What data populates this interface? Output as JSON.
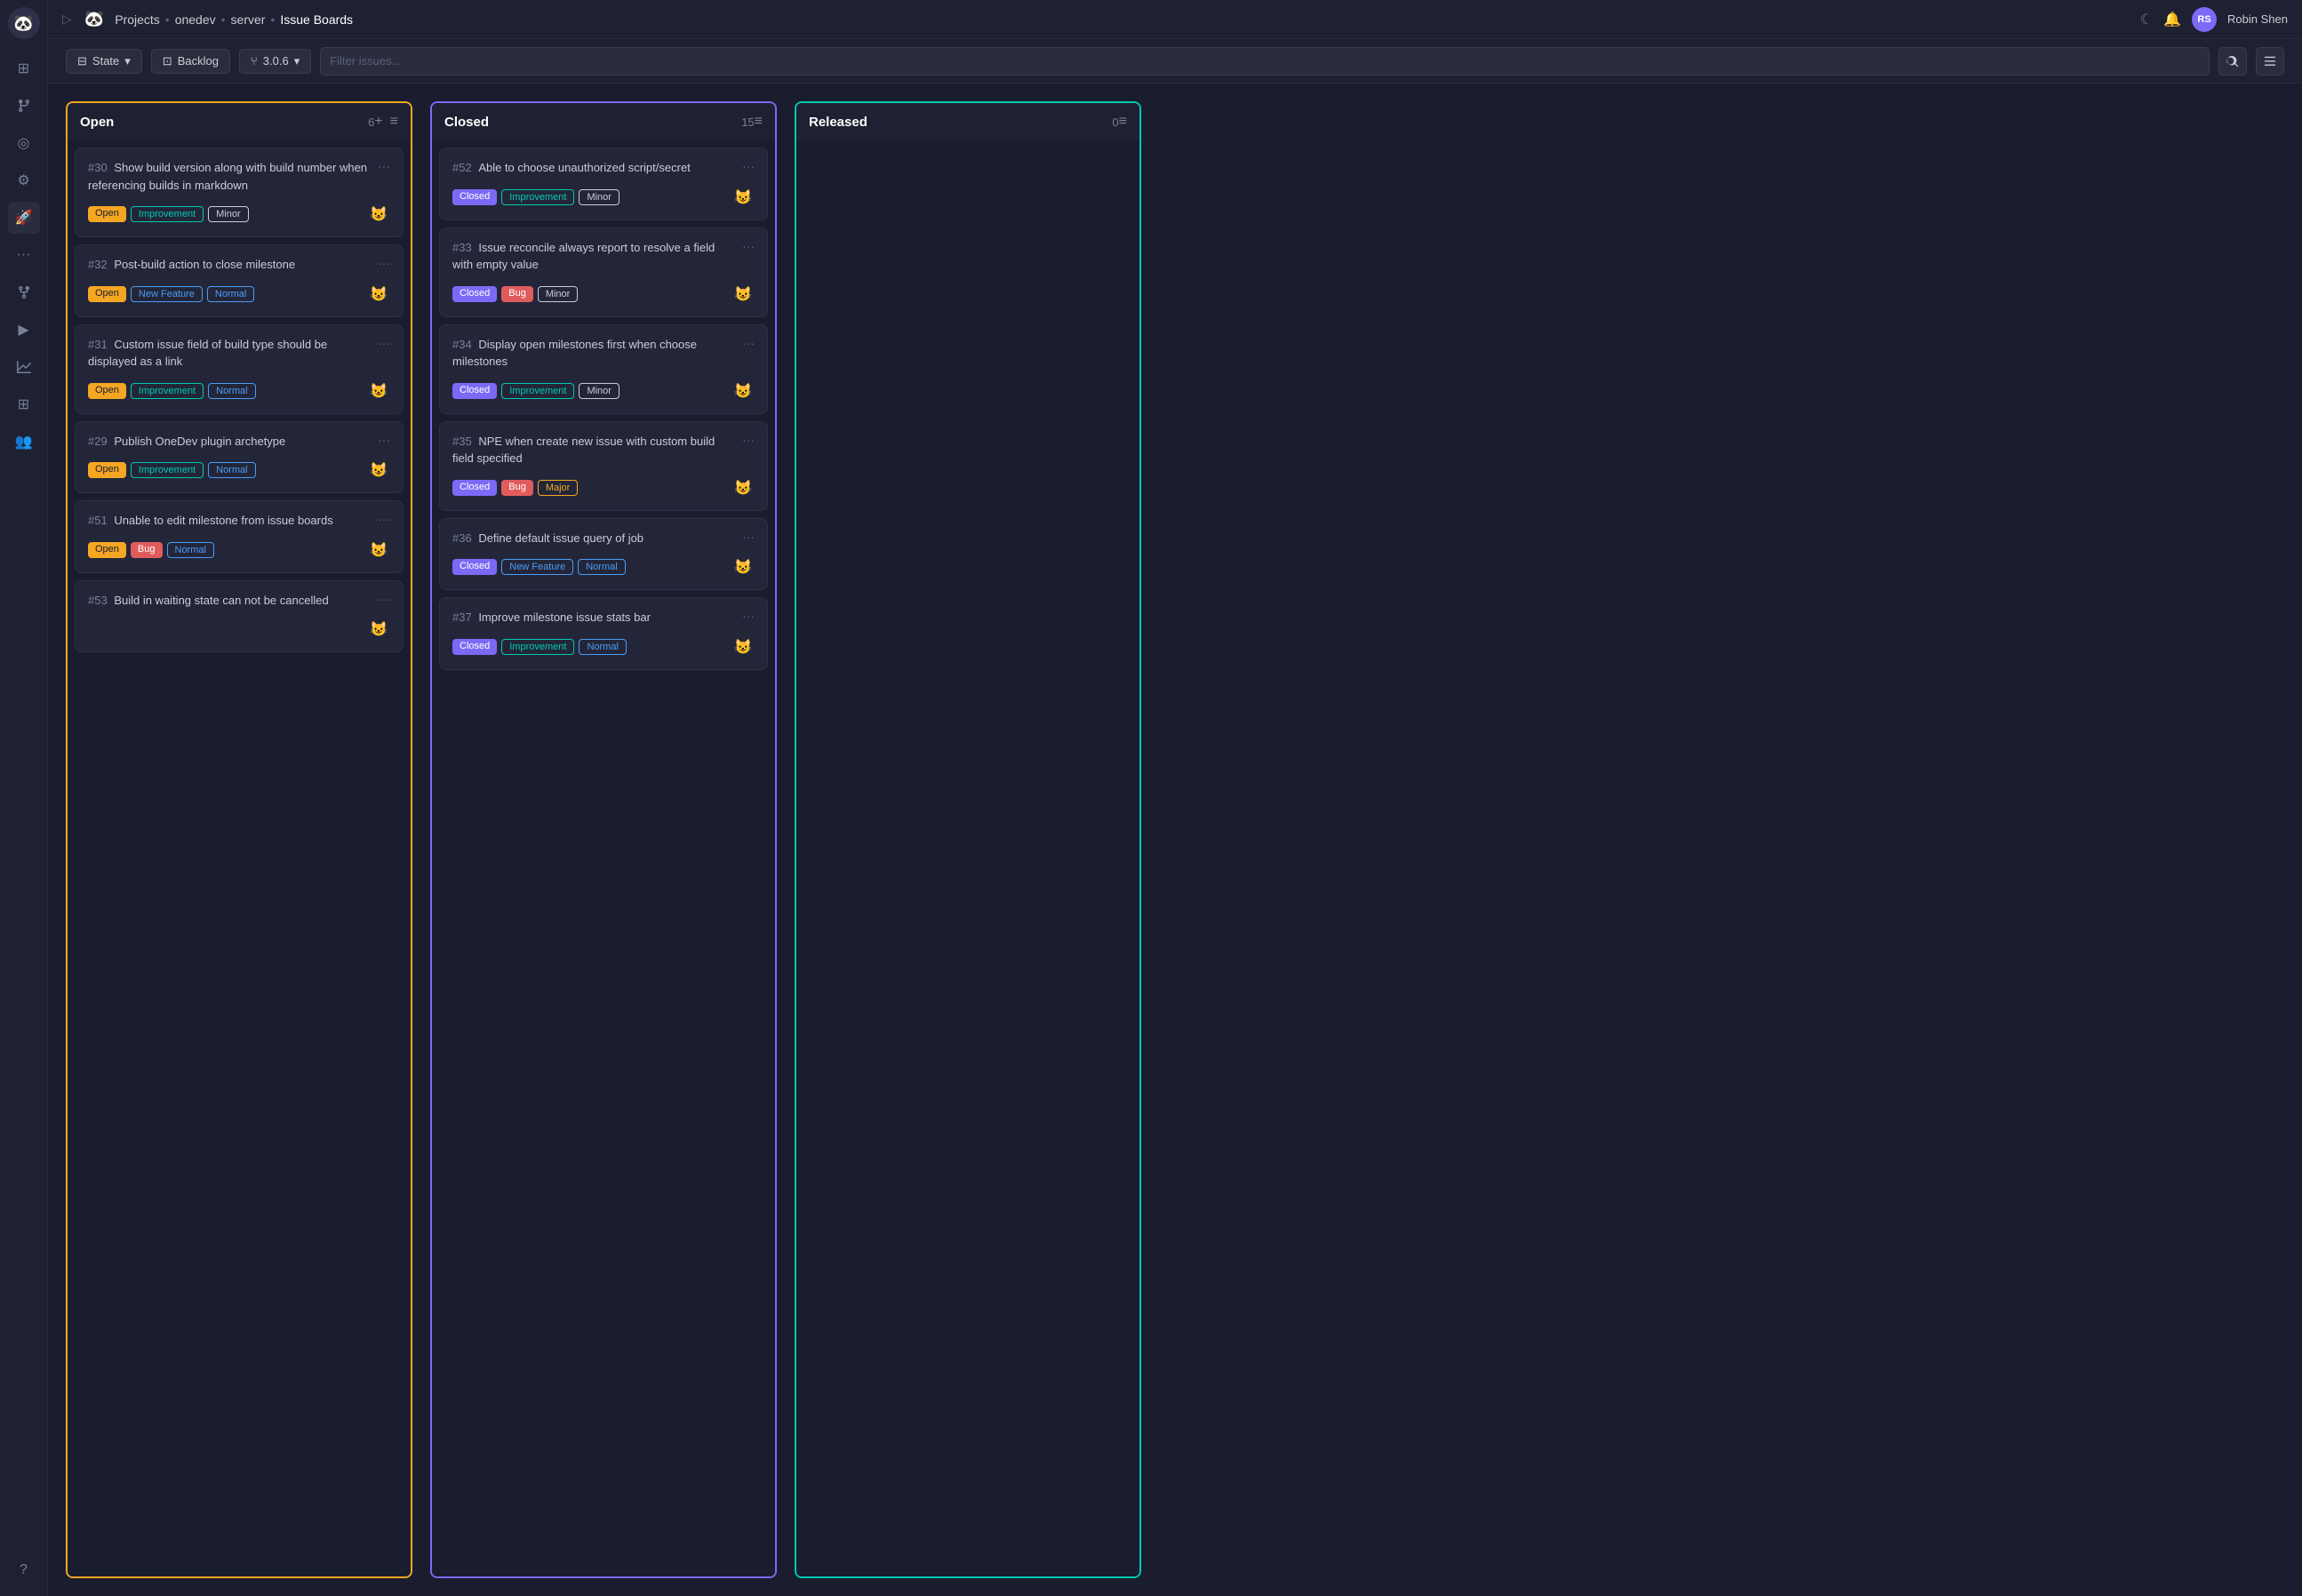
{
  "app": {
    "logo": "🐼",
    "breadcrumb": [
      "Projects",
      "onedev",
      "server",
      "Issue Boards"
    ]
  },
  "topnav": {
    "actions": {
      "moon_icon": "☾",
      "bell_icon": "🔔",
      "user_name": "Robin Shen"
    }
  },
  "toolbar": {
    "state_label": "State",
    "backlog_label": "Backlog",
    "version_label": "3.0.6",
    "search_placeholder": "Filter issues...",
    "chevron": "▾"
  },
  "sidebar": {
    "icons": [
      {
        "name": "dashboard",
        "symbol": "⊞"
      },
      {
        "name": "git-branches",
        "symbol": "⑂"
      },
      {
        "name": "releases",
        "symbol": "◎"
      },
      {
        "name": "settings",
        "symbol": "⚙"
      },
      {
        "name": "rocket",
        "symbol": "🚀"
      },
      {
        "name": "more",
        "symbol": "···"
      },
      {
        "name": "git-merge",
        "symbol": "⑂"
      },
      {
        "name": "build",
        "symbol": "▶"
      },
      {
        "name": "chart",
        "symbol": "📊"
      },
      {
        "name": "grid",
        "symbol": "⊞"
      },
      {
        "name": "team",
        "symbol": "👥"
      },
      {
        "name": "help",
        "symbol": "?"
      }
    ]
  },
  "columns": [
    {
      "id": "open",
      "title": "Open",
      "count": 6,
      "color_class": "column-open",
      "cards": [
        {
          "id": "30",
          "title": "Show build version along with build number when referencing builds in markdown",
          "tags": [
            {
              "label": "Open",
              "class": "tag-open"
            },
            {
              "label": "Improvement",
              "class": "tag-improvement"
            },
            {
              "label": "Minor",
              "class": "tag-minor"
            }
          ],
          "avatar": "😺"
        },
        {
          "id": "32",
          "title": "Post-build action to close milestone",
          "tags": [
            {
              "label": "Open",
              "class": "tag-open"
            },
            {
              "label": "New Feature",
              "class": "tag-new-feature"
            },
            {
              "label": "Normal",
              "class": "tag-normal"
            }
          ],
          "avatar": "😺"
        },
        {
          "id": "31",
          "title": "Custom issue field of build type should be displayed as a link",
          "tags": [
            {
              "label": "Open",
              "class": "tag-open"
            },
            {
              "label": "Improvement",
              "class": "tag-improvement"
            },
            {
              "label": "Normal",
              "class": "tag-normal"
            }
          ],
          "avatar": "😺"
        },
        {
          "id": "29",
          "title": "Publish OneDev plugin archetype",
          "tags": [
            {
              "label": "Open",
              "class": "tag-open"
            },
            {
              "label": "Improvement",
              "class": "tag-improvement"
            },
            {
              "label": "Normal",
              "class": "tag-normal"
            }
          ],
          "avatar": "😺"
        },
        {
          "id": "51",
          "title": "Unable to edit milestone from issue boards",
          "tags": [
            {
              "label": "Open",
              "class": "tag-open"
            },
            {
              "label": "Bug",
              "class": "tag-bug"
            },
            {
              "label": "Normal",
              "class": "tag-normal"
            }
          ],
          "avatar": "😺"
        },
        {
          "id": "53",
          "title": "Build in waiting state can not be cancelled",
          "tags": [],
          "avatar": "😺"
        }
      ]
    },
    {
      "id": "closed",
      "title": "Closed",
      "count": 15,
      "color_class": "column-closed",
      "cards": [
        {
          "id": "52",
          "title": "Able to choose unauthorized script/secret",
          "tags": [
            {
              "label": "Closed",
              "class": "tag-closed"
            },
            {
              "label": "Improvement",
              "class": "tag-improvement"
            },
            {
              "label": "Minor",
              "class": "tag-minor"
            }
          ],
          "avatar": "😺"
        },
        {
          "id": "33",
          "title": "Issue reconcile always report to resolve a field with empty value",
          "tags": [
            {
              "label": "Closed",
              "class": "tag-closed"
            },
            {
              "label": "Bug",
              "class": "tag-bug"
            },
            {
              "label": "Minor",
              "class": "tag-minor"
            }
          ],
          "avatar": "😺"
        },
        {
          "id": "34",
          "title": "Display open milestones first when choose milestones",
          "tags": [
            {
              "label": "Closed",
              "class": "tag-closed"
            },
            {
              "label": "Improvement",
              "class": "tag-improvement"
            },
            {
              "label": "Minor",
              "class": "tag-minor"
            }
          ],
          "avatar": "😺"
        },
        {
          "id": "35",
          "title": "NPE when create new issue with custom build field specified",
          "tags": [
            {
              "label": "Closed",
              "class": "tag-closed"
            },
            {
              "label": "Bug",
              "class": "tag-bug"
            },
            {
              "label": "Major",
              "class": "tag-major"
            }
          ],
          "avatar": "😺"
        },
        {
          "id": "36",
          "title": "Define default issue query of job",
          "tags": [
            {
              "label": "Closed",
              "class": "tag-closed"
            },
            {
              "label": "New Feature",
              "class": "tag-new-feature"
            },
            {
              "label": "Normal",
              "class": "tag-normal"
            }
          ],
          "avatar": "😺"
        },
        {
          "id": "37",
          "title": "Improve milestone issue stats bar",
          "tags": [
            {
              "label": "Closed",
              "class": "tag-closed"
            },
            {
              "label": "Improvement",
              "class": "tag-improvement"
            },
            {
              "label": "Normal",
              "class": "tag-normal"
            }
          ],
          "avatar": "😺"
        }
      ]
    },
    {
      "id": "released",
      "title": "Released",
      "count": 0,
      "color_class": "column-released",
      "cards": []
    }
  ]
}
